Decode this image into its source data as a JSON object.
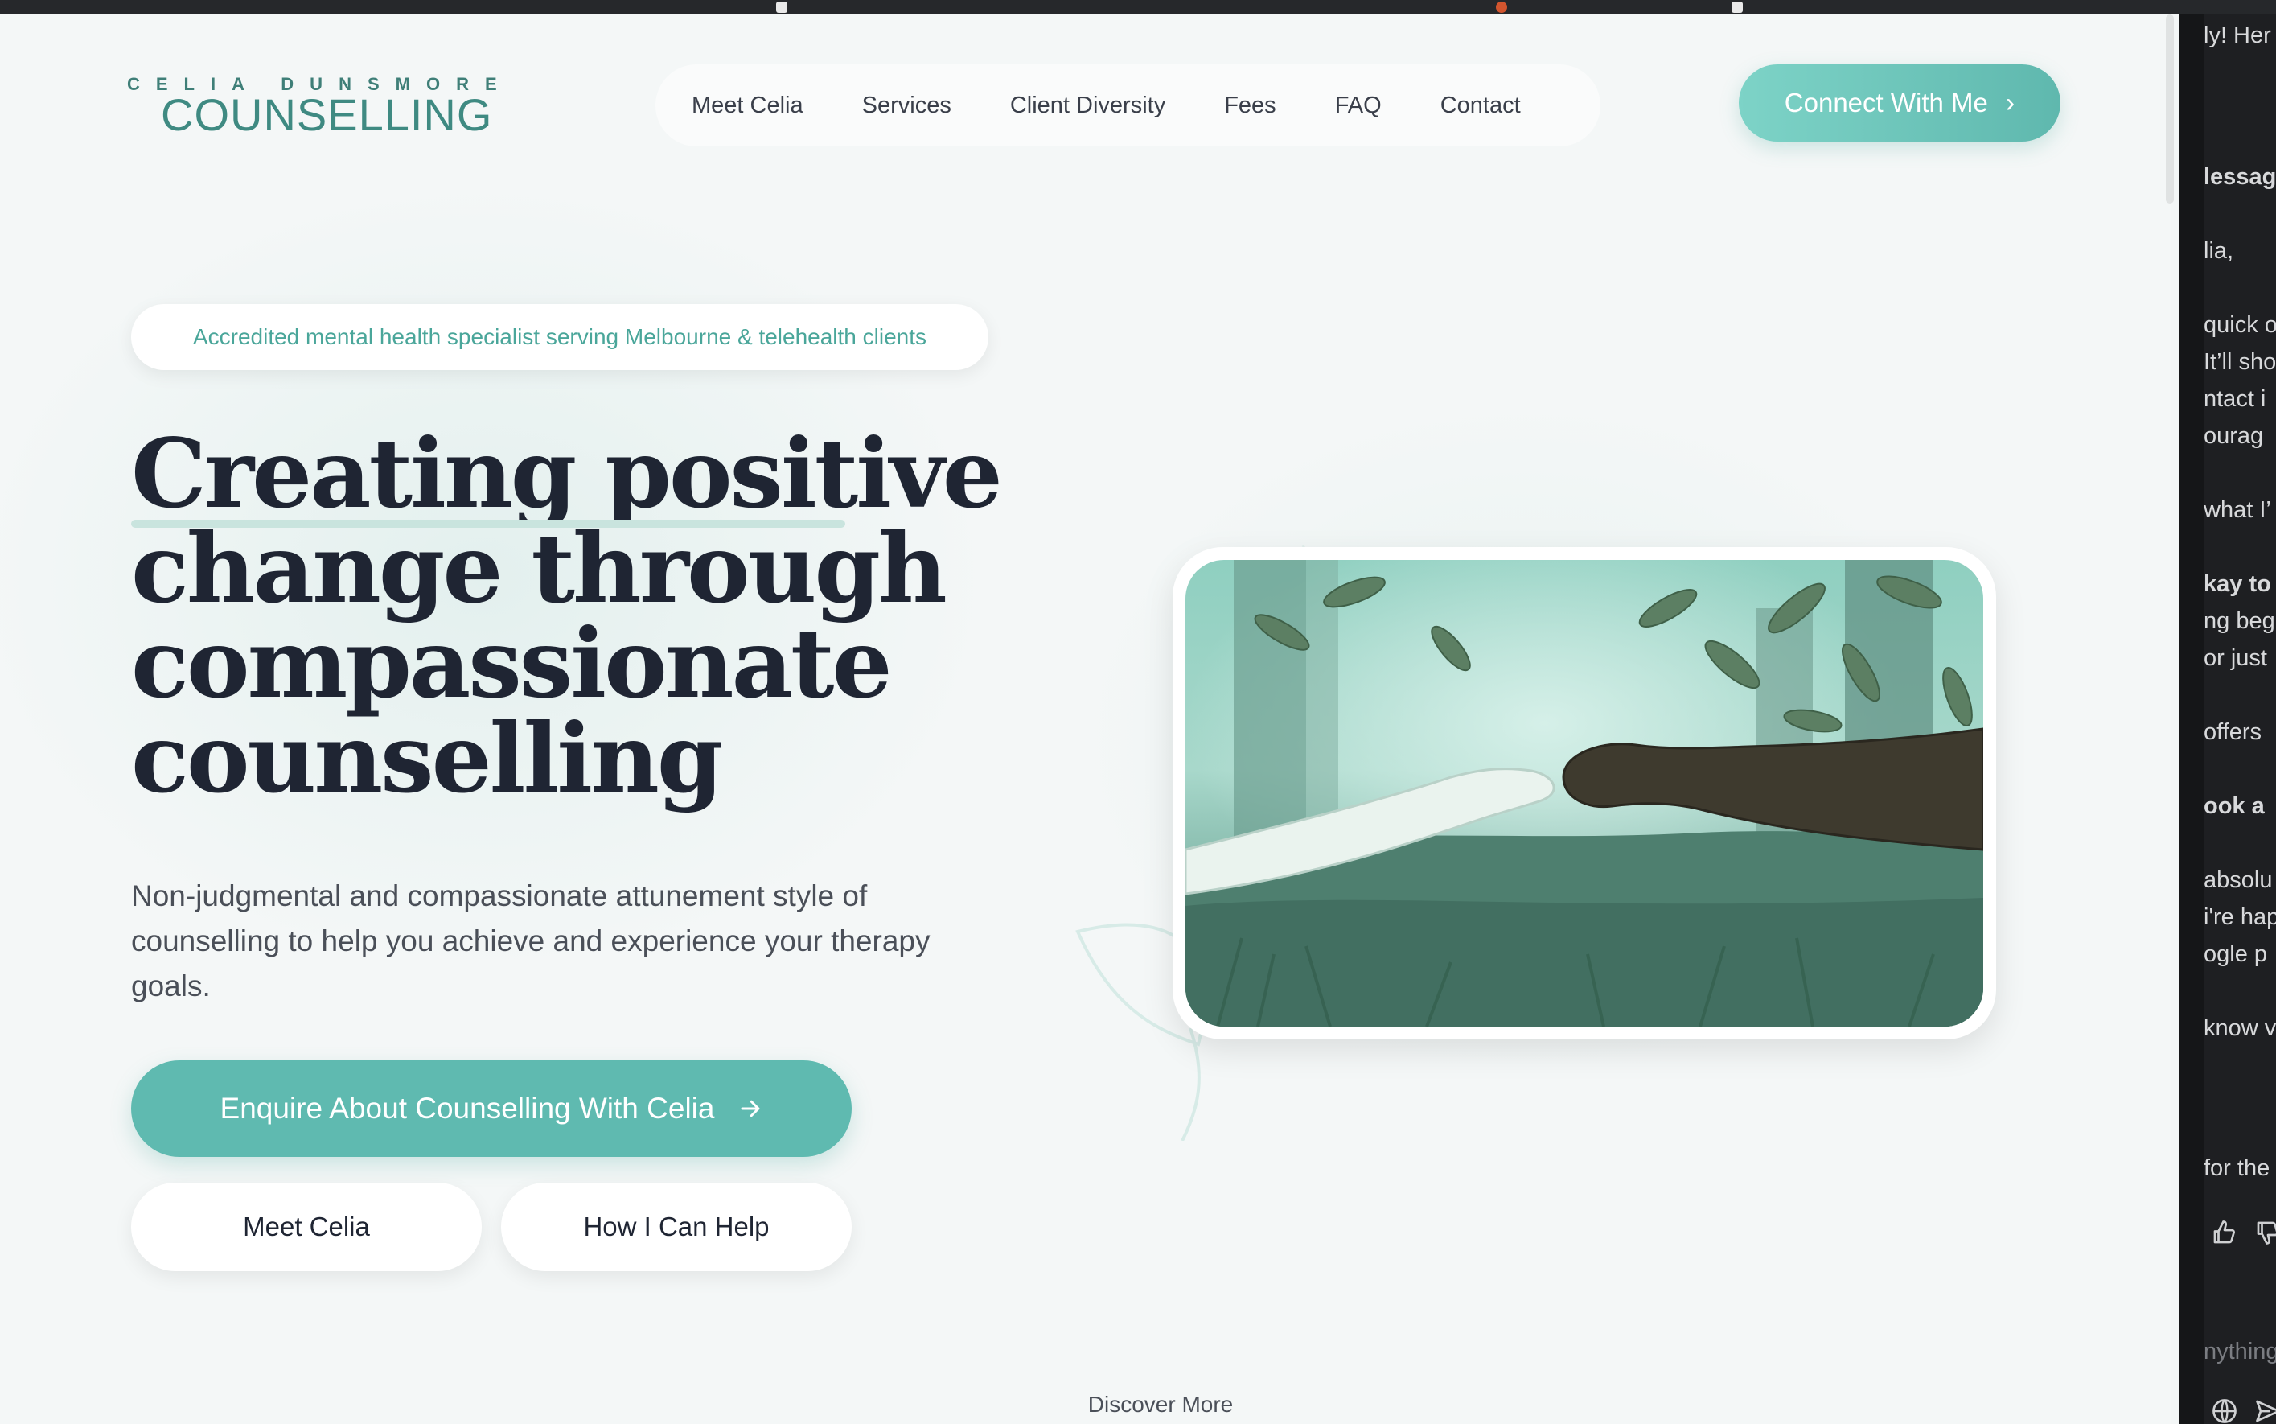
{
  "logo": {
    "top": "CELIA DUNSMORE",
    "bottom": "COUNSELLING"
  },
  "nav": {
    "items": [
      "Meet Celia",
      "Services",
      "Client Diversity",
      "Fees",
      "FAQ",
      "Contact"
    ]
  },
  "connect_button": {
    "label": "Connect With Me",
    "icon": "chevron-right-icon"
  },
  "badge": {
    "text": "Accredited mental health specialist serving Melbourne & telehealth clients"
  },
  "hero": {
    "title_lines": [
      "Creating positive",
      "change through",
      "compassionate",
      "counselling"
    ],
    "description": "Non-judgmental and compassionate attunement style of counselling to help you achieve and experience your therapy goals.",
    "primary_button": "Enquire About Counselling With Celia",
    "secondary_buttons": [
      "Meet Celia",
      "How I Can Help"
    ],
    "discover": "Discover More"
  },
  "side_panel": {
    "lines": [
      {
        "text": "ly! Her",
        "bold": false
      },
      {
        "text": "lessag",
        "bold": true
      },
      {
        "text": "lia,",
        "bold": false
      },
      {
        "text": "quick o",
        "bold": false
      },
      {
        "text": "It’ll sho",
        "bold": false
      },
      {
        "text": "ntact i",
        "bold": false
      },
      {
        "text": "ourag",
        "bold": false
      },
      {
        "text": "what I’",
        "bold": false
      },
      {
        "text": "kay to",
        "bold": true
      },
      {
        "text": "ng beg",
        "bold": false
      },
      {
        "text": "or just",
        "bold": false
      },
      {
        "text": "offers",
        "bold": false
      },
      {
        "text": "ook a",
        "bold": true
      },
      {
        "text": "absolu",
        "bold": false
      },
      {
        "text": "i're hap",
        "bold": false
      },
      {
        "text": "ogle p",
        "bold": false
      },
      {
        "text": "know v",
        "bold": false
      },
      {
        "text": "for the",
        "bold": false
      },
      {
        "text": "nything",
        "bold": false
      }
    ],
    "icons": [
      "thumbs-up-icon",
      "thumbs-down-icon",
      "globe-icon",
      "send-icon"
    ]
  },
  "colors": {
    "accent": "#5fbab0",
    "dark_text": "#1f2533",
    "badge_text": "#4aa69a",
    "side_bg": "#1e1f22"
  }
}
